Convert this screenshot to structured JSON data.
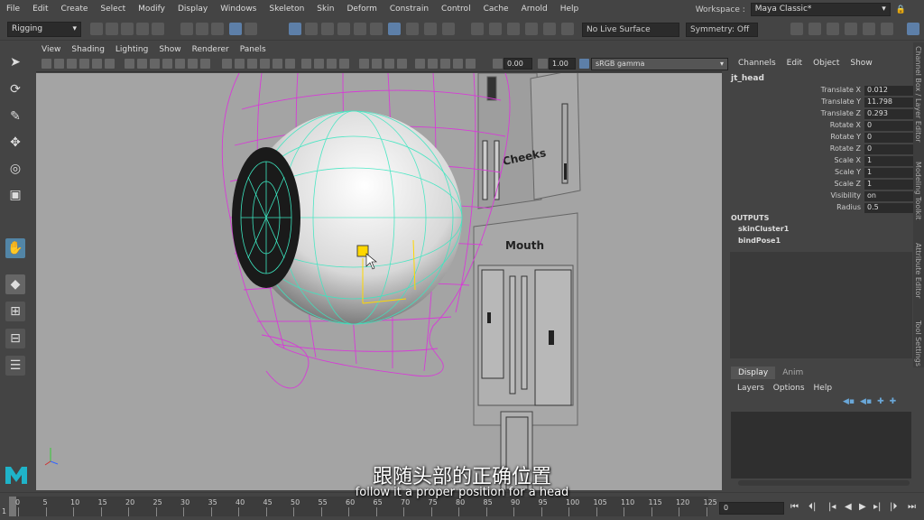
{
  "menubar": [
    "File",
    "Edit",
    "Create",
    "Select",
    "Modify",
    "Display",
    "Windows",
    "Skeleton",
    "Skin",
    "Deform",
    "Constrain",
    "Control",
    "Cache",
    "Arnold",
    "Help"
  ],
  "workspace": {
    "label": "Workspace :",
    "value": "Maya Classic*"
  },
  "statusline": {
    "mode": "Rigging",
    "live_surface": "No Live Surface",
    "symmetry": "Symmetry: Off"
  },
  "panel_menu": [
    "View",
    "Shading",
    "Lighting",
    "Show",
    "Renderer",
    "Panels"
  ],
  "panel_toolbar": {
    "exposure": "0.00",
    "gamma": "1.00",
    "color_space": "sRGB gamma"
  },
  "viewport": {
    "labels": [
      "Cheeks",
      "Mouth"
    ]
  },
  "channel_box": {
    "menu": [
      "Channels",
      "Edit",
      "Object",
      "Show"
    ],
    "node": "jt_head",
    "attributes": [
      {
        "name": "Translate X",
        "value": "0.012"
      },
      {
        "name": "Translate Y",
        "value": "11.798"
      },
      {
        "name": "Translate Z",
        "value": "0.293"
      },
      {
        "name": "Rotate X",
        "value": "0"
      },
      {
        "name": "Rotate Y",
        "value": "0"
      },
      {
        "name": "Rotate Z",
        "value": "0"
      },
      {
        "name": "Scale X",
        "value": "1"
      },
      {
        "name": "Scale Y",
        "value": "1"
      },
      {
        "name": "Scale Z",
        "value": "1"
      },
      {
        "name": "Visibility",
        "value": "on"
      },
      {
        "name": "Radius",
        "value": "0.5"
      }
    ],
    "outputs_label": "OUTPUTS",
    "outputs": [
      "skinCluster1",
      "bindPose1"
    ]
  },
  "side_tabs": [
    "Channel Box / Layer Editor",
    "Modeling Toolkit",
    "Attribute Editor",
    "Tool Settings"
  ],
  "layer_editor": {
    "tabs": [
      "Display",
      "Anim"
    ],
    "menu": [
      "Layers",
      "Options",
      "Help"
    ]
  },
  "timeslider": {
    "ticks": [
      "0",
      "5",
      "10",
      "15",
      "20",
      "25",
      "30",
      "35",
      "40",
      "45",
      "50",
      "55",
      "60",
      "65",
      "70",
      "75",
      "80",
      "85",
      "90",
      "95",
      "100",
      "105",
      "110",
      "115",
      "120",
      "125"
    ],
    "current_frame": "0",
    "range_start": "1"
  },
  "subtitles": {
    "zh": "跟随头部的正确位置",
    "en": "follow it a proper position for a head"
  },
  "colors": {
    "accent": "#5285a6",
    "wire_magenta": "#d63cd6",
    "wire_cyan": "#3ce6c0"
  }
}
